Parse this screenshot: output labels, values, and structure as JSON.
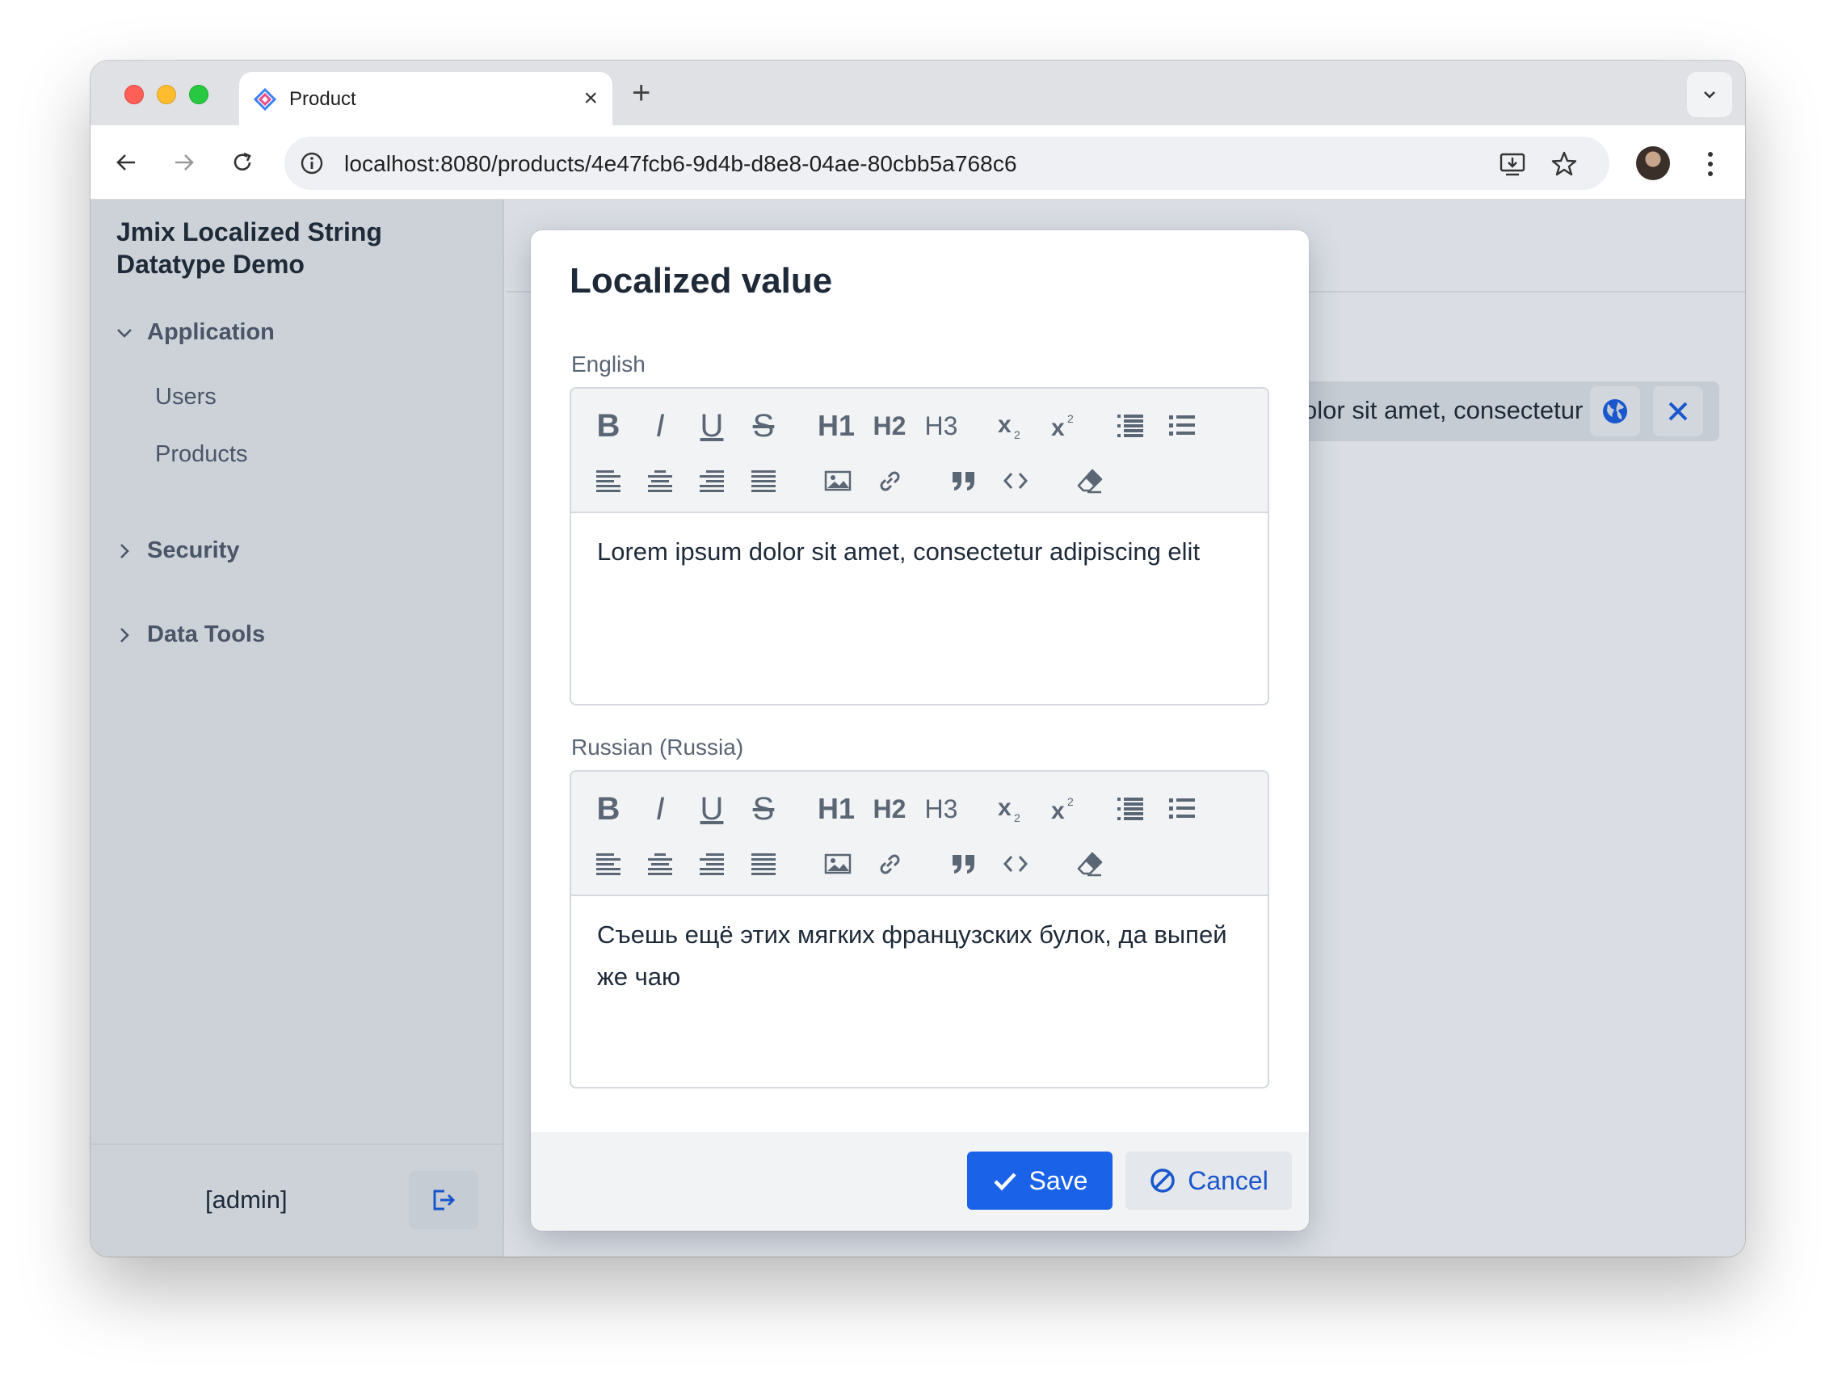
{
  "browser": {
    "tab_title": "Product",
    "url": "localhost:8080/products/4e47fcb6-9d4b-d8e8-04ae-80cbb5a768c6"
  },
  "app": {
    "title": "Jmix Localized String Datatype Demo",
    "nav": {
      "application_label": "Application",
      "items": [
        {
          "label": "Users"
        },
        {
          "label": "Products"
        }
      ],
      "security_label": "Security",
      "data_tools_label": "Data Tools"
    },
    "user_label": "[admin]",
    "background_field_value": "Lorem ipsum dolor sit amet, consectetur adipiscing elit"
  },
  "dialog": {
    "title": "Localized value",
    "fields": [
      {
        "label": "English",
        "content": "Lorem ipsum dolor sit amet, consectetur adipiscing elit"
      },
      {
        "label": "Russian (Russia)",
        "content": "Съешь ещё этих мягких французских булок, да выпей же чаю"
      }
    ],
    "save_label": "Save",
    "cancel_label": "Cancel"
  },
  "toolbar_icons": [
    "bold-icon",
    "italic-icon",
    "underline-icon",
    "strikethrough-icon",
    "h1-icon",
    "h2-icon",
    "h3-icon",
    "subscript-icon",
    "superscript-icon",
    "ordered-list-icon",
    "bullet-list-icon",
    "align-left-icon",
    "align-center-icon",
    "align-right-icon",
    "align-justify-icon",
    "image-icon",
    "link-icon",
    "blockquote-icon",
    "code-icon",
    "clear-format-icon"
  ],
  "colors": {
    "primary": "#1a63e8",
    "sidebar_bg": "#cdd2d9",
    "app_bg": "#dadee4"
  }
}
